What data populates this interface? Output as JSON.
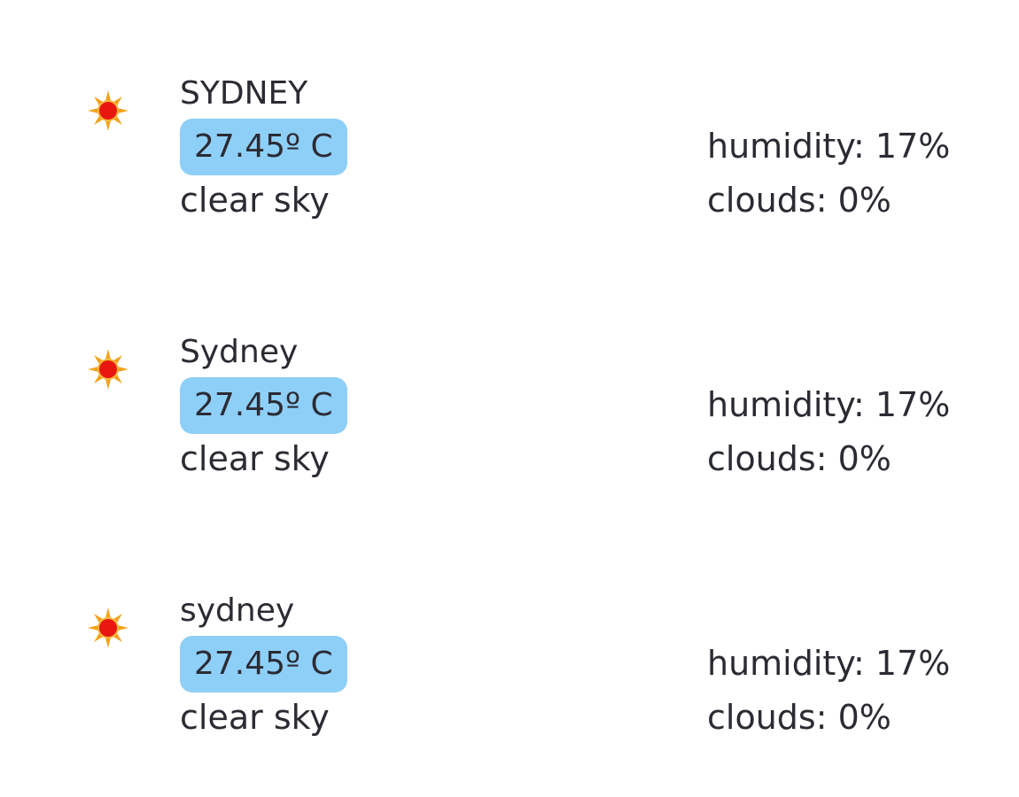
{
  "cities": [
    {
      "icon": "sun-icon",
      "name": "SYDNEY",
      "temperature": "27.45º C",
      "description": "clear sky",
      "humidity": "humidity: 17%",
      "clouds": "clouds: 0%"
    },
    {
      "icon": "sun-icon",
      "name": "Sydney",
      "temperature": "27.45º C",
      "description": "clear sky",
      "humidity": "humidity: 17%",
      "clouds": "clouds: 0%"
    },
    {
      "icon": "sun-icon",
      "name": "sydney",
      "temperature": "27.45º C",
      "description": "clear sky",
      "humidity": "humidity: 17%",
      "clouds": "clouds: 0%"
    }
  ],
  "colors": {
    "temp_badge": "#8ecff8",
    "text": "#2b2b33",
    "sun_core": "#e8170f",
    "sun_rays": "#f4a21c"
  }
}
